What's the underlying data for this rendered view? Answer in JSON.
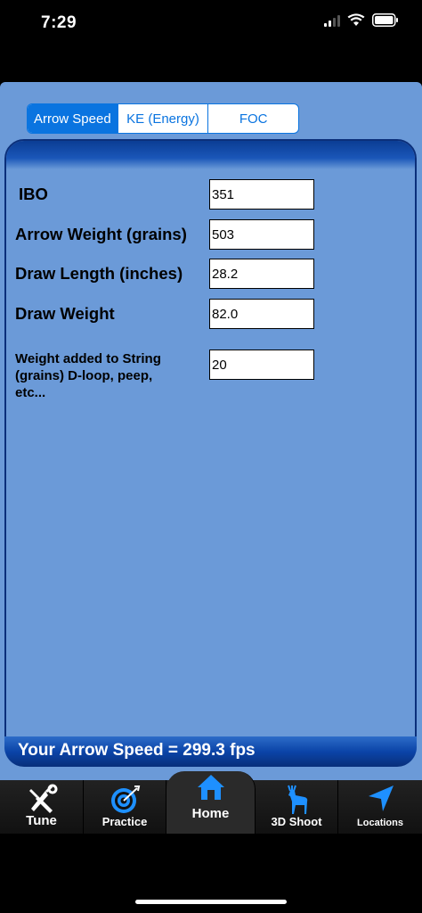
{
  "status": {
    "time": "7:29"
  },
  "tabs_segment": [
    {
      "label": "Arrow Speed",
      "selected": true
    },
    {
      "label": "KE (Energy)",
      "selected": false
    },
    {
      "label": "FOC",
      "selected": false
    }
  ],
  "form": {
    "ibo": {
      "label": "IBO",
      "value": "351"
    },
    "arrow_weight": {
      "label": "Arrow Weight (grains)",
      "value": "503"
    },
    "draw_length": {
      "label": "Draw Length (inches)",
      "value": "28.2"
    },
    "draw_weight": {
      "label": "Draw Weight",
      "value": "82.0"
    },
    "string_weight": {
      "label": "Weight added to String (grains) D-loop, peep, etc...",
      "value": "20"
    }
  },
  "result": {
    "text": "Your Arrow Speed = 299.3 fps"
  },
  "tabbar": {
    "tune": "Tune",
    "practice": "Practice",
    "home": "Home",
    "shoot3d": "3D Shoot",
    "locations": "Locations"
  },
  "colors": {
    "accent": "#0a74e0",
    "panel": "#6b9ad8",
    "header": "#0b3d94",
    "icon_blue": "#1e90ff"
  }
}
